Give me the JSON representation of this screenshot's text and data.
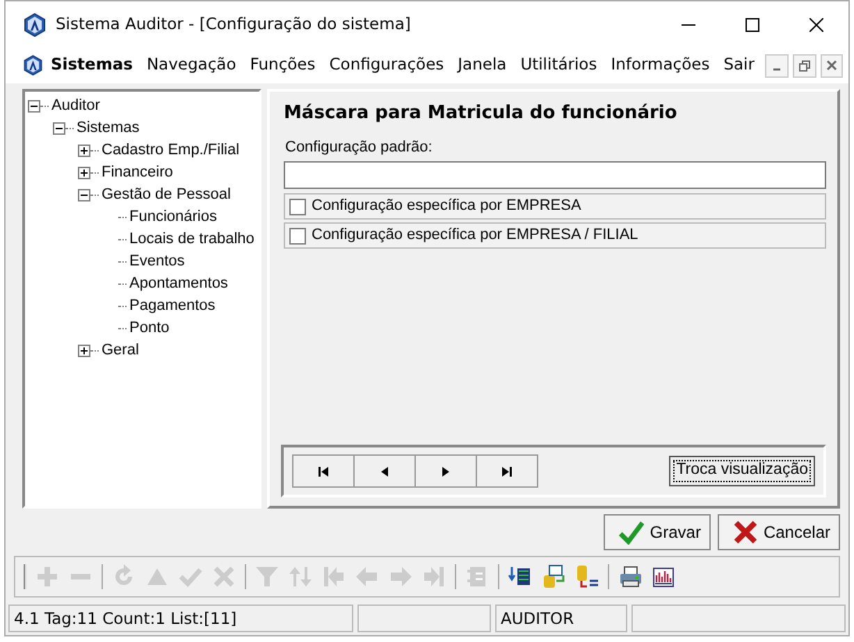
{
  "window": {
    "title": "Sistema Auditor - [Configuração do sistema]"
  },
  "menu": [
    {
      "label": "Sistemas",
      "bold": true
    },
    {
      "label": "Navegação",
      "bold": false
    },
    {
      "label": "Funções",
      "bold": false
    },
    {
      "label": "Configurações",
      "bold": false
    },
    {
      "label": "Janela",
      "bold": false
    },
    {
      "label": "Utilitários",
      "bold": false
    },
    {
      "label": "Informações",
      "bold": false
    },
    {
      "label": "Sair",
      "bold": false
    }
  ],
  "tree": [
    {
      "label": "Auditor",
      "expanded": true,
      "children": [
        {
          "label": "Sistemas",
          "expanded": true,
          "children": [
            {
              "label": "Cadastro Emp./Filial",
              "expanded": false
            },
            {
              "label": "Financeiro",
              "expanded": false
            },
            {
              "label": "Gestão de Pessoal",
              "expanded": true,
              "children": [
                {
                  "label": "Funcionários"
                },
                {
                  "label": "Locais de trabalho"
                },
                {
                  "label": "Eventos"
                },
                {
                  "label": "Apontamentos"
                },
                {
                  "label": "Pagamentos"
                },
                {
                  "label": "Ponto"
                }
              ]
            },
            {
              "label": "Geral",
              "expanded": false
            }
          ]
        }
      ]
    }
  ],
  "panel": {
    "title": "Máscara para Matricula do funcionário",
    "field_label": "Configuração padrão:",
    "options": [
      {
        "label": "Configuração específica por EMPRESA",
        "checked": false
      },
      {
        "label": "Configuração específica por EMPRESA / FILIAL",
        "checked": false
      }
    ],
    "view_button": "Troca visualização"
  },
  "buttons": [
    {
      "kind": "save",
      "label": "Gravar"
    },
    {
      "kind": "cancel",
      "label": "Cancelar"
    }
  ],
  "toolbar": [
    [
      {
        "disabled": true
      },
      {
        "disabled": true
      }
    ],
    [
      {
        "disabled": true
      },
      {
        "disabled": true
      },
      {
        "disabled": true
      },
      {
        "disabled": true
      }
    ],
    [
      {
        "disabled": true
      },
      {
        "disabled": true
      },
      {
        "disabled": true
      },
      {
        "disabled": true
      },
      {
        "disabled": true
      },
      {
        "disabled": true
      }
    ],
    [
      {
        "disabled": true
      }
    ],
    [
      {
        "disabled": false
      },
      {
        "disabled": false
      },
      {
        "disabled": false
      }
    ],
    [
      {
        "disabled": false
      },
      {
        "disabled": false
      }
    ]
  ],
  "status_bar": [
    "4.1 Tag:11 Count:1 List:[11]",
    "AUDITOR"
  ]
}
